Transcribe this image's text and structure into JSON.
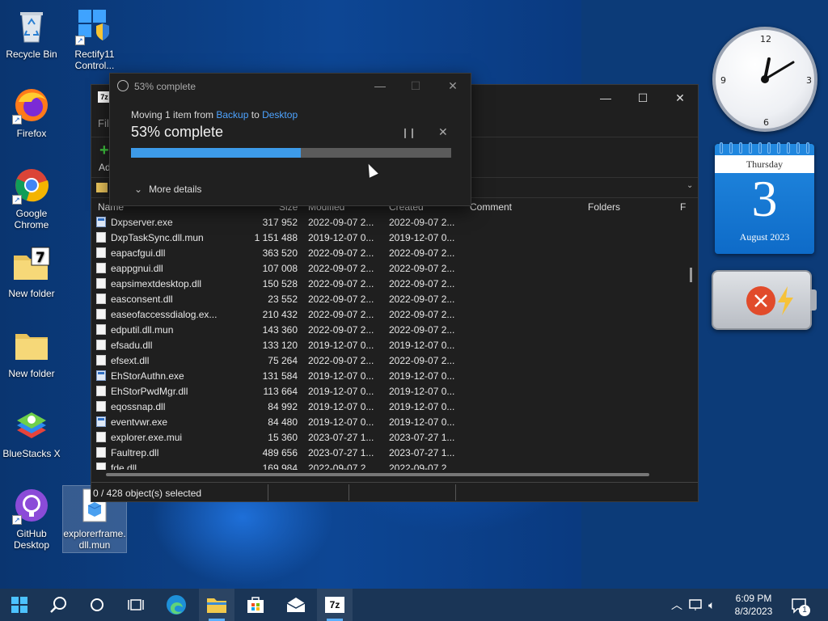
{
  "desktop": {
    "icons": [
      {
        "label": "Recycle Bin"
      },
      {
        "label": "Rectify11 Control..."
      },
      {
        "label": "Firefox"
      },
      {
        "label": "Google Chrome"
      },
      {
        "label": "New folder"
      },
      {
        "label": "New folder"
      },
      {
        "label": "BlueStacks X"
      },
      {
        "label": "GitHub Desktop"
      },
      {
        "label": "explorerframe.dll.mun"
      }
    ]
  },
  "widgets": {
    "clock": {
      "n12": "12",
      "n3": "3",
      "n6": "6",
      "n9": "9",
      "time_shown": "1:10"
    },
    "calendar": {
      "weekday": "Thursday",
      "day": "3",
      "month_year": "August 2023"
    },
    "battery": {
      "status_icon": "error-icon",
      "charging_icon": "lightning-icon"
    }
  },
  "zip_window": {
    "app_icon": "7z",
    "menu_first": "Fil",
    "toolbar_add": "Ad",
    "columns": {
      "name": "Name",
      "size": "Size",
      "modified": "Modified",
      "created": "Created",
      "comment": "Comment",
      "folders": "Folders",
      "f": "F"
    },
    "rows": [
      {
        "icon": "exe",
        "name": "Dxpserver.exe",
        "size": "317 952",
        "modified": "2022-09-07 2...",
        "created": "2022-09-07 2..."
      },
      {
        "icon": "dll",
        "name": "DxpTaskSync.dll.mun",
        "size": "1 151 488",
        "modified": "2019-12-07 0...",
        "created": "2019-12-07 0..."
      },
      {
        "icon": "dll",
        "name": "eapacfgui.dll",
        "size": "363 520",
        "modified": "2022-09-07 2...",
        "created": "2022-09-07 2..."
      },
      {
        "icon": "dll",
        "name": "eappgnui.dll",
        "size": "107 008",
        "modified": "2022-09-07 2...",
        "created": "2022-09-07 2..."
      },
      {
        "icon": "dll",
        "name": "eapsimextdesktop.dll",
        "size": "150 528",
        "modified": "2022-09-07 2...",
        "created": "2022-09-07 2..."
      },
      {
        "icon": "dll",
        "name": "easconsent.dll",
        "size": "23 552",
        "modified": "2022-09-07 2...",
        "created": "2022-09-07 2..."
      },
      {
        "icon": "dll",
        "name": "easeofaccessdialog.ex...",
        "size": "210 432",
        "modified": "2022-09-07 2...",
        "created": "2022-09-07 2..."
      },
      {
        "icon": "dll",
        "name": "edputil.dll.mun",
        "size": "143 360",
        "modified": "2022-09-07 2...",
        "created": "2022-09-07 2..."
      },
      {
        "icon": "dll",
        "name": "efsadu.dll",
        "size": "133 120",
        "modified": "2019-12-07 0...",
        "created": "2019-12-07 0..."
      },
      {
        "icon": "dll",
        "name": "efsext.dll",
        "size": "75 264",
        "modified": "2022-09-07 2...",
        "created": "2022-09-07 2..."
      },
      {
        "icon": "exe",
        "name": "EhStorAuthn.exe",
        "size": "131 584",
        "modified": "2019-12-07 0...",
        "created": "2019-12-07 0..."
      },
      {
        "icon": "dll",
        "name": "EhStorPwdMgr.dll",
        "size": "113 664",
        "modified": "2019-12-07 0...",
        "created": "2019-12-07 0..."
      },
      {
        "icon": "dll",
        "name": "eqossnap.dll",
        "size": "84 992",
        "modified": "2019-12-07 0...",
        "created": "2019-12-07 0..."
      },
      {
        "icon": "exe",
        "name": "eventvwr.exe",
        "size": "84 480",
        "modified": "2019-12-07 0...",
        "created": "2019-12-07 0..."
      },
      {
        "icon": "dll",
        "name": "explorer.exe.mui",
        "size": "15 360",
        "modified": "2023-07-27 1...",
        "created": "2023-07-27 1..."
      },
      {
        "icon": "dll",
        "name": "Faultrep.dll",
        "size": "489 656",
        "modified": "2023-07-27 1...",
        "created": "2023-07-27 1..."
      },
      {
        "icon": "dll",
        "name": "fde.dll",
        "size": "169 984",
        "modified": "2022-09-07 2...",
        "created": "2022-09-07 2..."
      }
    ],
    "status": "0 / 428 object(s) selected"
  },
  "progress_dialog": {
    "title": "53% complete",
    "moving_prefix": "Moving 1 item from ",
    "source": "Backup",
    "moving_mid": " to ",
    "destination": "Desktop",
    "percent_text": "53% complete",
    "progress": 0.53,
    "more_details": "More details",
    "pause_icon": "pause-icon",
    "cancel_icon": "close-icon"
  },
  "taskbar": {
    "items": [
      "start-icon",
      "search-icon",
      "cortana-icon",
      "task-view-icon",
      "edge-icon",
      "file-explorer-icon",
      "store-icon",
      "mail-icon",
      "7zip-icon"
    ],
    "time": "6:09 PM",
    "date": "8/3/2023",
    "notification_count": "1",
    "app_7z_label": "7z"
  }
}
